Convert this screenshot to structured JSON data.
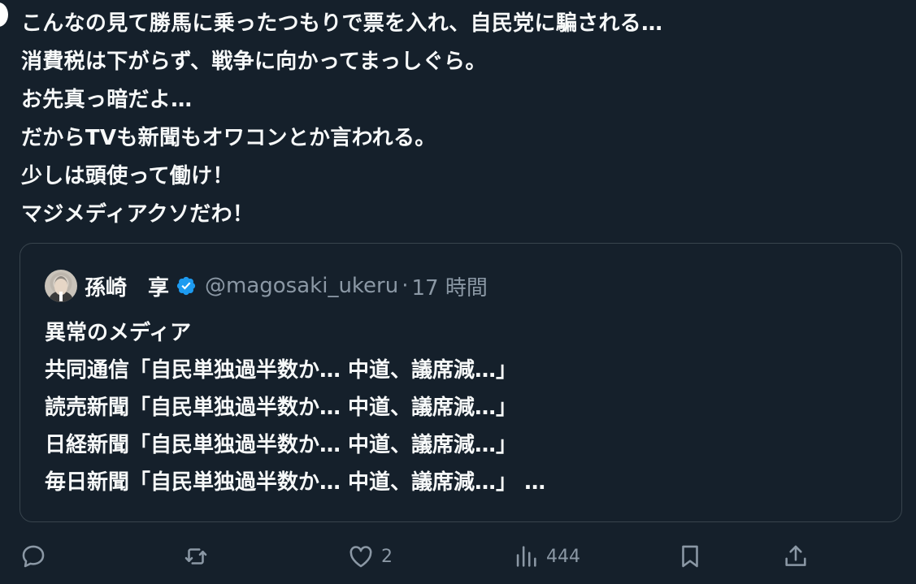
{
  "post": {
    "lines": [
      "こんなの見て勝馬に乗ったつもりで票を入れ、自民党に騙される…",
      "消費税は下がらず、戦争に向かってまっしぐら。",
      "お先真っ暗だよ…",
      "だからTVも新聞もオワコンとか言われる。",
      "少しは頭使って働け！",
      "マジメディアクソだわ！"
    ]
  },
  "quote": {
    "author_name": "孫崎　享",
    "handle": "@magosaki_ukeru",
    "separator": "·",
    "time": "17 時間",
    "lines": [
      "異常のメディア",
      "共同通信「自民単独過半数か… 中道、議席減…」",
      "読売新聞「自民単独過半数か… 中道、議席減…」",
      "日経新聞「自民単独過半数か… 中道、議席減…」",
      "毎日新聞「自民単独過半数か… 中道、議席減…」 …"
    ]
  },
  "actions": {
    "reply_icon": "reply-icon",
    "repost_icon": "repost-icon",
    "like_icon": "like-icon",
    "like_count": "2",
    "views_icon": "views-icon",
    "views_count": "444",
    "bookmark_icon": "bookmark-icon",
    "share_icon": "share-icon"
  },
  "colors": {
    "background": "#15202b",
    "text": "#f7f9f9",
    "secondary_text": "#8b98a5",
    "border": "#38444d",
    "verified": "#1d9bf0"
  }
}
